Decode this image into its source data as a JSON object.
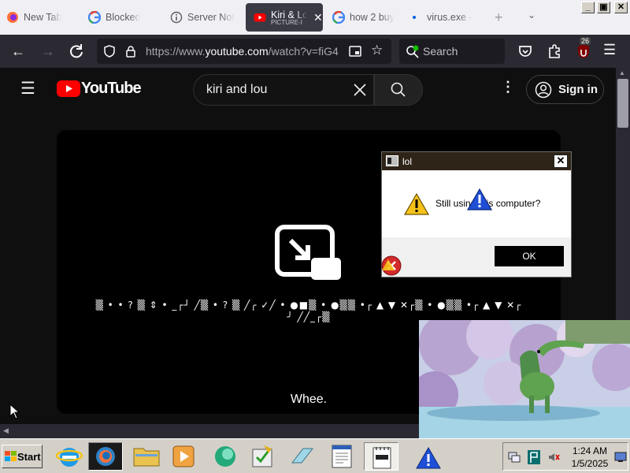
{
  "browser": {
    "tabs": [
      {
        "title": "New Tab",
        "icon": "firefox-icon",
        "active": false
      },
      {
        "title": "Blocked",
        "icon": "google-icon",
        "active": false
      },
      {
        "title": "Server Not",
        "icon": "info-icon",
        "active": false
      },
      {
        "title": "Kiri & Lo",
        "subtitle": "PICTURE-I",
        "icon": "youtube-icon",
        "active": true
      },
      {
        "title": "how 2 buy",
        "icon": "google-icon",
        "active": false
      },
      {
        "title": "virus.exe -",
        "icon": "loading-dot-icon",
        "active": false
      }
    ],
    "url": {
      "prefix": "https://www.",
      "host": "youtube.com",
      "path": "/watch?v=fiG4"
    },
    "search_placeholder": "Search",
    "extension_badge": "26"
  },
  "youtube": {
    "logo_text": "YouTube",
    "search_value": "kiri and lou",
    "signin_label": "Sign in",
    "player_message": "▒ • • ? ▒ ⇕ • _┌┘ ╱▒ • ? ▒ ╱╭ ✓╱ • ●■▒ • ●▒▒ •┌ ▲ ▼ ✕┌▒ • ●▒▒ •┌ ▲ ▼ ✕┌",
    "player_message_line2": "╯ ╱╱_┌▒",
    "caption": "Whee."
  },
  "dialog": {
    "title": "lol",
    "message": "Still using this computer?",
    "ok_label": "OK"
  },
  "taskbar": {
    "start_label": "Start",
    "clock_time": "1:24 AM",
    "clock_date": "1/5/2025"
  }
}
